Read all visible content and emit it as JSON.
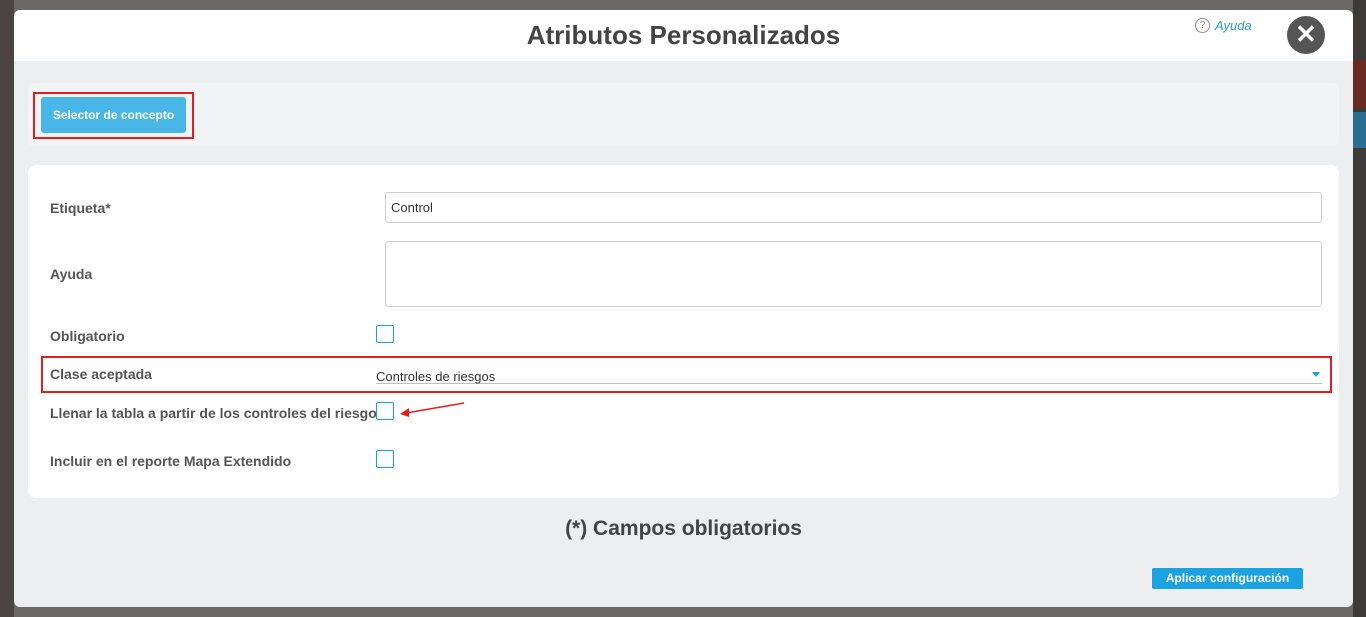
{
  "modal": {
    "title": "Atributos Personalizados",
    "help_label": "Ayuda",
    "help_icon": "?",
    "close_icon": "✕"
  },
  "toolbar": {
    "concept_selector_label": "Selector de concepto"
  },
  "form": {
    "label_field": {
      "label": "Etiqueta*",
      "value": "Control"
    },
    "help_field": {
      "label": "Ayuda",
      "value": ""
    },
    "required_field": {
      "label": "Obligatorio",
      "checked": false
    },
    "accepted_class": {
      "label": "Clase aceptada",
      "value": "Controles de riesgos"
    },
    "fill_from_controls": {
      "label": "Llenar la tabla a partir de los controles del riesgo",
      "checked": false
    },
    "include_extended_map": {
      "label": "Incluir en el reporte Mapa Extendido",
      "checked": false
    }
  },
  "footer": {
    "required_note": "(*) Campos obligatorios",
    "apply_label": "Aplicar configuración"
  },
  "colors": {
    "accent": "#1aa3e0",
    "highlight": "#e02020",
    "title": "#444444"
  }
}
